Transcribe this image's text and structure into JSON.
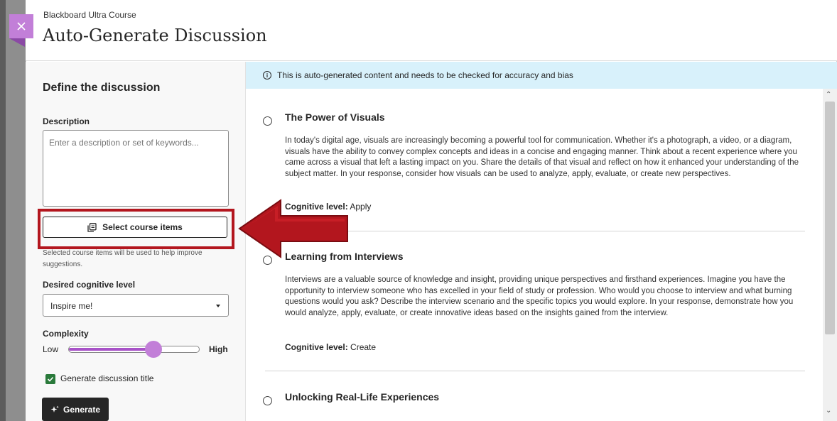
{
  "header": {
    "course_name": "Blackboard Ultra Course",
    "title": "Auto-Generate Discussion"
  },
  "sidebar": {
    "title": "Define the discussion",
    "description_label": "Description",
    "description_placeholder": "Enter a description or set of keywords...",
    "select_course_items_label": "Select course items",
    "select_hint": "Selected course items will be used to help improve suggestions.",
    "cognitive_label": "Desired cognitive level",
    "cognitive_value": "Inspire me!",
    "complexity_label": "Complexity",
    "complexity_low": "Low",
    "complexity_high": "High",
    "complexity_level": 0.65,
    "generate_title_label": "Generate discussion title",
    "generate_title_checked": true,
    "generate_label": "Generate"
  },
  "banner": {
    "text": "This is auto-generated content and needs to be checked for accuracy and bias"
  },
  "results": [
    {
      "title": "The Power of Visuals",
      "body": "In today's digital age, visuals are increasingly becoming a powerful tool for communication. Whether it's a photograph, a video, or a diagram, visuals have the ability to convey complex concepts and ideas in a concise and engaging manner. Think about a recent experience where you came across a visual that left a lasting impact on you. Share the details of that visual and reflect on how it enhanced your understanding of the subject matter. In your response, consider how visuals can be used to analyze, apply, evaluate, or create new perspectives.",
      "level_label": "Cognitive level:",
      "level": "Apply"
    },
    {
      "title": "Learning from Interviews",
      "body": "Interviews are a valuable source of knowledge and insight, providing unique perspectives and firsthand experiences. Imagine you have the opportunity to interview someone who has excelled in your field of study or profession. Who would you choose to interview and what burning questions would you ask? Describe the interview scenario and the specific topics you would explore. In your response, demonstrate how you would analyze, apply, evaluate, or create innovative ideas based on the insights gained from the interview.",
      "level_label": "Cognitive level:",
      "level": "Create"
    },
    {
      "title": "Unlocking Real-Life Experiences"
    }
  ],
  "colors": {
    "accent": "#c27fd8",
    "highlight": "#b3161e",
    "banner": "#d8f1fb",
    "checkbox": "#2a7a3b"
  }
}
